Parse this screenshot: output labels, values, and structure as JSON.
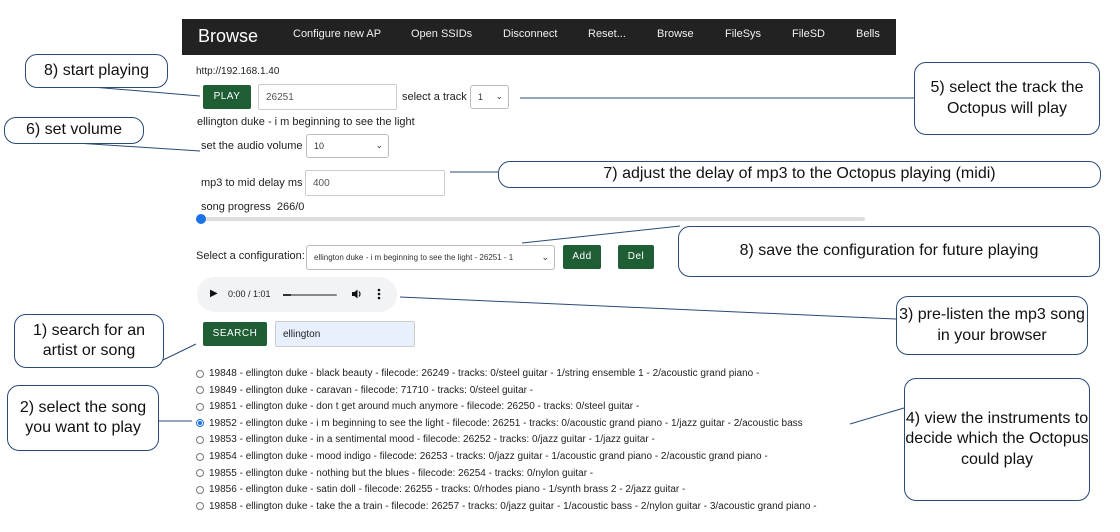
{
  "navbar": {
    "brand": "Browse",
    "links": [
      "Configure new AP",
      "Open SSIDs",
      "Disconnect",
      "Reset...",
      "Browse",
      "FileSys",
      "FileSD",
      "Bells"
    ]
  },
  "url": "http://192.168.1.40",
  "player": {
    "play_label": "PLAY",
    "filecode_value": "26251",
    "track_label": "select a track",
    "track_value": "1",
    "now_playing": "ellington duke - i m beginning to see the light"
  },
  "volume": {
    "label": "set the audio volume",
    "value": "10"
  },
  "delay": {
    "label": "mp3 to mid delay ms",
    "value": "400"
  },
  "progress": {
    "label": "song progress",
    "value_text": "266/0",
    "fraction": 0.0
  },
  "configuration": {
    "label": "Select a configuration:",
    "selected": "ellington duke - i m beginning to see the light - 26251 - 1",
    "add_label": "Add",
    "del_label": "Del"
  },
  "audio": {
    "time": "0:00 / 1:01"
  },
  "search": {
    "button_label": "SEARCH",
    "value": "ellington"
  },
  "results": [
    {
      "text": "19848 - ellington duke - black beauty - filecode: 26249 - tracks: 0/steel guitar - 1/string ensemble 1 - 2/acoustic grand piano -",
      "selected": false
    },
    {
      "text": "19849 - ellington duke - caravan - filecode: 71710 - tracks: 0/steel guitar -",
      "selected": false
    },
    {
      "text": "19851 - ellington duke - don t get around much anymore - filecode: 26250 - tracks: 0/steel guitar -",
      "selected": false
    },
    {
      "text": "19852 - ellington duke - i m beginning to see the light - filecode: 26251 - tracks: 0/acoustic grand piano - 1/jazz guitar - 2/acoustic bass",
      "selected": true
    },
    {
      "text": "19853 - ellington duke - in a sentimental mood - filecode: 26252 - tracks: 0/jazz guitar - 1/jazz guitar -",
      "selected": false
    },
    {
      "text": "19854 - ellington duke - mood indigo - filecode: 26253 - tracks: 0/jazz guitar - 1/acoustic grand piano - 2/acoustic grand piano -",
      "selected": false
    },
    {
      "text": "19855 - ellington duke - nothing but the blues - filecode: 26254 - tracks: 0/nylon guitar -",
      "selected": false
    },
    {
      "text": "19856 - ellington duke - satin doll - filecode: 26255 - tracks: 0/rhodes piano - 1/synth brass 2 - 2/jazz guitar -",
      "selected": false
    },
    {
      "text": "19858 - ellington duke - take the a train - filecode: 26257 - tracks: 0/jazz guitar - 1/acoustic bass - 2/nylon guitar - 3/acoustic grand piano -",
      "selected": false
    }
  ],
  "callouts": {
    "start_playing": "8) start playing",
    "select_track": "5) select the track the Octopus will play",
    "set_volume": "6) set volume",
    "adjust_delay": "7) adjust the delay of mp3 to the Octopus playing (midi)",
    "save_config": "8) save the configuration for future playing",
    "prelisten": "3) pre-listen the mp3 song in your browser",
    "search_artist": "1) search for an artist or song",
    "select_song": "2) select the song you want to play",
    "view_instruments": "4) view the instruments to decide which the Octopus could play"
  },
  "colors": {
    "navbar": "#222222",
    "button": "#1f5e34",
    "callout_border": "#2a4a78",
    "radio_selected": "#1a73e8"
  }
}
